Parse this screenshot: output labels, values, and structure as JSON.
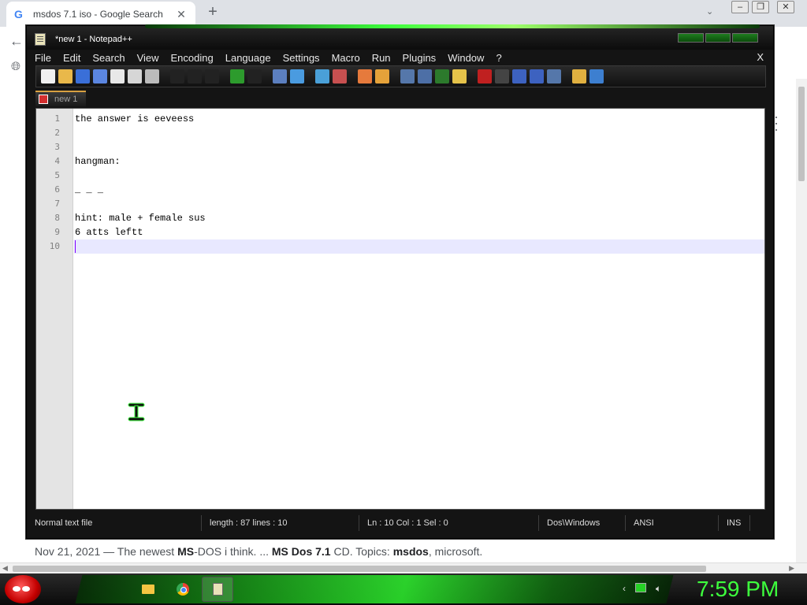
{
  "browser": {
    "tab_title": "msdos 7.1 iso - Google Search",
    "tab_favicon": "google-g-icon",
    "page_snippet_date": "Nov 21, 2021 — The newest ",
    "page_snippet_b1": "MS",
    "page_snippet_t1": "-DOS i think. ... ",
    "page_snippet_b2": "MS Dos 7.1",
    "page_snippet_t2": " CD. Topics: ",
    "page_snippet_b3": "msdos",
    "page_snippet_t3": ", microsoft."
  },
  "npp": {
    "title": "*new  1 - Notepad++",
    "menu": [
      "File",
      "Edit",
      "Search",
      "View",
      "Encoding",
      "Language",
      "Settings",
      "Macro",
      "Run",
      "Plugins",
      "Window",
      "?"
    ],
    "menu_close": "X",
    "doc_tab": "new  1",
    "lines": [
      "the answer is eeveess",
      "",
      "",
      "hangman:",
      "",
      "_ _ _",
      "",
      "hint: male + female sus",
      "6 atts leftt",
      ""
    ],
    "line_numbers": [
      "1",
      "2",
      "3",
      "4",
      "5",
      "6",
      "7",
      "8",
      "9",
      "10"
    ],
    "status": {
      "type": "Normal text file",
      "length": "length : 87    lines : 10",
      "pos": "Ln : 10    Col : 1    Sel : 0",
      "eol": "Dos\\Windows",
      "encoding": "ANSI",
      "mode": "INS"
    },
    "colors": {
      "accent_green": "#3dff3d",
      "current_line": "#e8e8ff",
      "caret": "#8000ff"
    }
  },
  "taskbar": {
    "clock": "7:59 PM",
    "apps": [
      "folder-icon",
      "chrome-icon",
      "notepad-icon"
    ]
  }
}
